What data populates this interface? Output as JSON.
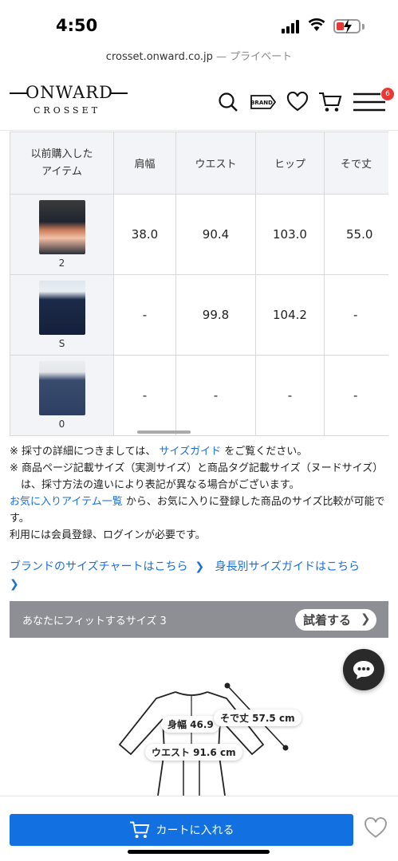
{
  "status_bar": {
    "time": "4:50"
  },
  "url_bar": {
    "domain": "crosset.onward.co.jp",
    "private_label": "— プライベート"
  },
  "header": {
    "logo_main": "ONWARD",
    "logo_sub": "CROSSET",
    "icons": [
      "search-icon",
      "brand-icon",
      "heart-icon",
      "cart-icon",
      "menu-icon"
    ],
    "brand_icon_text": "BRAND",
    "menu_badge": "6"
  },
  "size_table": {
    "headers": [
      "以前購入した\nアイテム",
      "肩幅",
      "ウエスト",
      "ヒップ",
      "そで丈"
    ],
    "rows": [
      {
        "size": "2",
        "values": [
          "38.0",
          "90.4",
          "103.0",
          "55.0"
        ]
      },
      {
        "size": "S",
        "values": [
          "-",
          "99.8",
          "104.2",
          "-"
        ]
      },
      {
        "size": "0",
        "values": [
          "-",
          "-",
          "-",
          "-"
        ]
      }
    ]
  },
  "notes": {
    "note1_prefix": "※ 採寸の詳細につきましては、",
    "note1_link": "サイズガイド",
    "note1_suffix": "をご覧ください。",
    "note2": "※ 商品ページ記載サイズ（実測サイズ）と商品タグ記載サイズ（ヌードサイズ）は、採寸方法の違いにより表記が異なる場合がございます。",
    "fav_link": "お気に入りアイテム一覧",
    "fav_suffix": "から、お気に入りに登録した商品のサイズ比較が可能です。",
    "login_note": "利用には会員登録、ログインが必要です。"
  },
  "links": {
    "brand_chart": "ブランドのサイズチャートはこちら",
    "height_guide": "身長別サイズガイドはこちら"
  },
  "fit_bar": {
    "label": "あなたにフィットするサイズ 3",
    "try_button": "試着する"
  },
  "illustration": {
    "body_width": "身幅 46.9",
    "sleeve_length": "そで丈 57.5 cm",
    "waist": "ウエスト 91.6 cm"
  },
  "bottom": {
    "cart_button": "カートに入れる"
  }
}
